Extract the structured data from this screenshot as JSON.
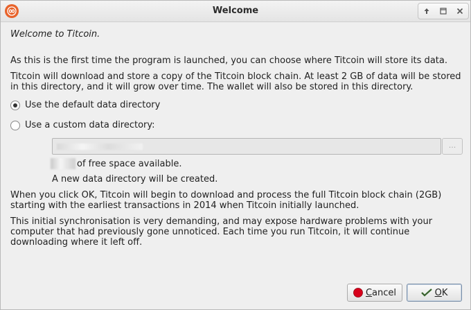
{
  "window": {
    "title": "Welcome"
  },
  "titlebar": {
    "buttons": [
      "up-arrow-icon",
      "maximize-icon",
      "close-icon"
    ]
  },
  "intro": {
    "heading": "Welcome to Titcoin.",
    "line1": "As this is the first time the program is launched, you can choose where Titcoin will store its data.",
    "line2a": "Titcoin will download and store a copy of the Titcoin block chain. At least 2 GB of data will be stored",
    "line2b": "in this directory, and it will grow over time. The wallet will also be stored in this directory."
  },
  "options": {
    "default_label": "Use the default data directory",
    "default_selected": true,
    "custom_label": "Use a custom data directory:",
    "custom_selected": false,
    "browse_label": "...",
    "free_space_suffix": "of free space available.",
    "new_dir_note": "A new data directory will be created."
  },
  "info": {
    "p1a": "When you click OK, Titcoin will begin to download and process the full Titcoin block chain (2GB)",
    "p1b": "starting with the earliest transactions in 2014 when Titcoin initially launched.",
    "p2a": "This initial synchronisation is very demanding, and may expose hardware problems with your",
    "p2b": "computer that had previously gone unnoticed. Each time you run Titcoin, it will continue",
    "p2c": "downloading where it left off."
  },
  "buttons": {
    "cancel_first": "C",
    "cancel_rest": "ancel",
    "ok_first": "O",
    "ok_rest": "K"
  },
  "colors": {
    "app_icon": "#e8632b",
    "cancel_icon": "#d7001b",
    "ok_icon": "#4a8a3a"
  }
}
